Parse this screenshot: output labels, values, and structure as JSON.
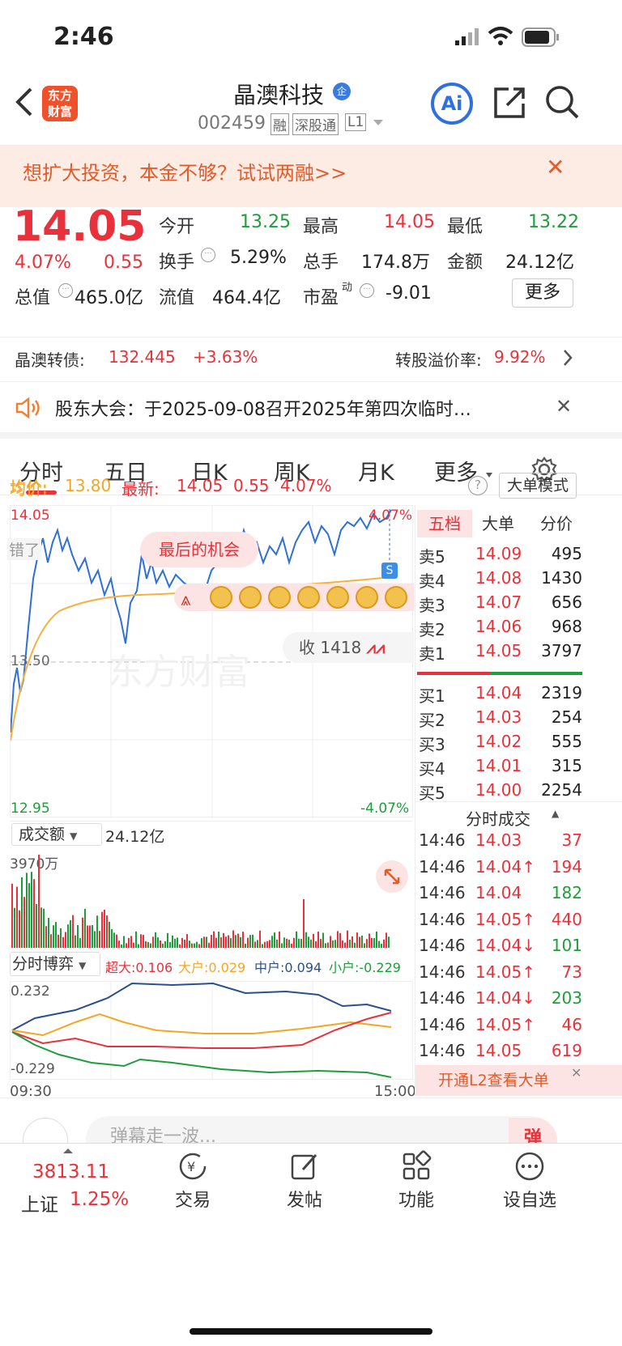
{
  "status": {
    "time": "2:46"
  },
  "nav": {
    "back": "‹",
    "logo_line1": "东方",
    "logo_line2": "财富",
    "title": "晶澳科技",
    "title_badge": "企",
    "code": "002459",
    "tags": [
      "融",
      "深股通",
      "L1"
    ],
    "ai": "Ai"
  },
  "banner": {
    "text": "想扩大投资，本金不够？试试两融>>",
    "close": "✕"
  },
  "quote": {
    "price": "14.05",
    "pct": "4.07%",
    "chg": "0.55",
    "fields": [
      {
        "label": "今开",
        "value": "13.25"
      },
      {
        "label": "最高",
        "value": "14.05"
      },
      {
        "label": "最低",
        "value": "13.22"
      },
      {
        "label": "换手",
        "value": "5.29%"
      },
      {
        "label": "总手",
        "value": "174.8万"
      },
      {
        "label": "金额",
        "value": "24.12亿"
      },
      {
        "label": "总值",
        "value": "465.0亿"
      },
      {
        "label": "流值",
        "value": "464.4亿"
      },
      {
        "label": "市盈",
        "value": "-9.01",
        "sup": "动"
      }
    ],
    "more": "更多"
  },
  "cb": {
    "label": "晶澳转债:",
    "price": "132.445",
    "pct": "+3.63%",
    "premium_label": "转股溢价率:",
    "premium": "9.92%"
  },
  "notice": {
    "text": "股东大会：于2025-09-08召开2025年第四次临时…"
  },
  "tabs": [
    "分时",
    "五日",
    "日K",
    "周K",
    "月K",
    "更多"
  ],
  "chart": {
    "avg_label": "均价:",
    "avg": "13.80",
    "last_label": "最新:",
    "last": "14.05",
    "last_chg": "0.55",
    "last_pct": "4.07%",
    "mode": "大单模式",
    "y_top": "14.05",
    "y_mid": "13.50",
    "y_bot": "12.95",
    "pct_top": "4.07%",
    "pct_bot": "-4.07%",
    "watermark": "东方财富",
    "promo": "最后的机会",
    "collect": "收 1418",
    "label_left": "错了",
    "x_start": "09:30",
    "x_end": "15:00"
  },
  "volume": {
    "label": "成交额",
    "total": "24.12亿",
    "max": "3970万"
  },
  "flow": {
    "label": "分时博弈",
    "super": "超大:0.106",
    "large": "大户:0.029",
    "mid": "中户:0.094",
    "small": "小户:-0.229",
    "top": "0.232",
    "bot": "-0.229"
  },
  "orderbook": {
    "tabs": [
      "五档",
      "大单",
      "分价"
    ],
    "asks": [
      {
        "l": "卖5",
        "p": "14.09",
        "v": "495"
      },
      {
        "l": "卖4",
        "p": "14.08",
        "v": "1430"
      },
      {
        "l": "卖3",
        "p": "14.07",
        "v": "656"
      },
      {
        "l": "卖2",
        "p": "14.06",
        "v": "968"
      },
      {
        "l": "卖1",
        "p": "14.05",
        "v": "3797"
      }
    ],
    "bids": [
      {
        "l": "买1",
        "p": "14.04",
        "v": "2319"
      },
      {
        "l": "买2",
        "p": "14.03",
        "v": "254"
      },
      {
        "l": "买3",
        "p": "14.02",
        "v": "555"
      },
      {
        "l": "买4",
        "p": "14.01",
        "v": "315"
      },
      {
        "l": "买5",
        "p": "14.00",
        "v": "2254"
      }
    ],
    "trades_title": "分时成交",
    "trades": [
      {
        "t": "14:46",
        "p": "14.03",
        "v": "37"
      },
      {
        "t": "14:46",
        "p": "14.04↑",
        "v": "194"
      },
      {
        "t": "14:46",
        "p": "14.04",
        "v": "182"
      },
      {
        "t": "14:46",
        "p": "14.05↑",
        "v": "440"
      },
      {
        "t": "14:46",
        "p": "14.04↓",
        "v": "101"
      },
      {
        "t": "14:46",
        "p": "14.05↑",
        "v": "73"
      },
      {
        "t": "14:46",
        "p": "14.04↓",
        "v": "203"
      },
      {
        "t": "14:46",
        "p": "14.05↑",
        "v": "46"
      },
      {
        "t": "14:46",
        "p": "14.05",
        "v": "619"
      }
    ],
    "l2": "开通L2查看大单"
  },
  "comment": {
    "placeholder": "弹幕走一波...",
    "btn": "弹"
  },
  "bottom": {
    "index_value": "3813.11",
    "index_name": "上证",
    "index_pct": "1.25%",
    "items": [
      "交易",
      "发帖",
      "功能",
      "设自选"
    ]
  }
}
